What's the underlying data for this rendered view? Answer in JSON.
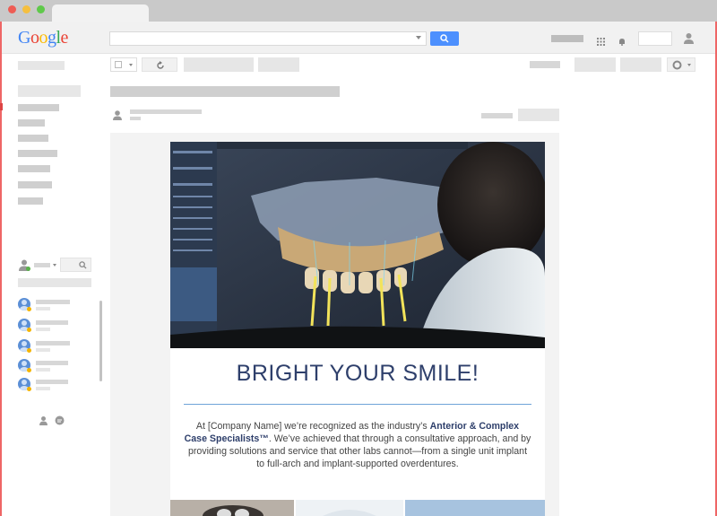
{
  "browser": {
    "logo_text": "Google",
    "logo_colors": [
      "#4285f4",
      "#ea4335",
      "#fbbc05",
      "#4285f4",
      "#34a853",
      "#ea4335"
    ]
  },
  "email": {
    "headline": "BRIGHT YOUR SMILE!",
    "body_intro": "At [Company Name] we’re recognized as the industry’s ",
    "body_bold": "Anterior & Complex Case Specialists™",
    "body_rest": ". We’ve achieved that through a consultative approach, and by providing solutions and service that other labs cannot—from a single unit implant to full-arch and implant-supported overdentures."
  },
  "colors": {
    "accent_blue": "#4d90fe",
    "headline": "#2e3f6b",
    "divider": "#6fa3d8"
  },
  "icons": [
    "search-icon",
    "grid-icon",
    "bell-icon",
    "account-icon",
    "refresh-icon",
    "settings-icon",
    "person-icon",
    "chat-icon"
  ]
}
